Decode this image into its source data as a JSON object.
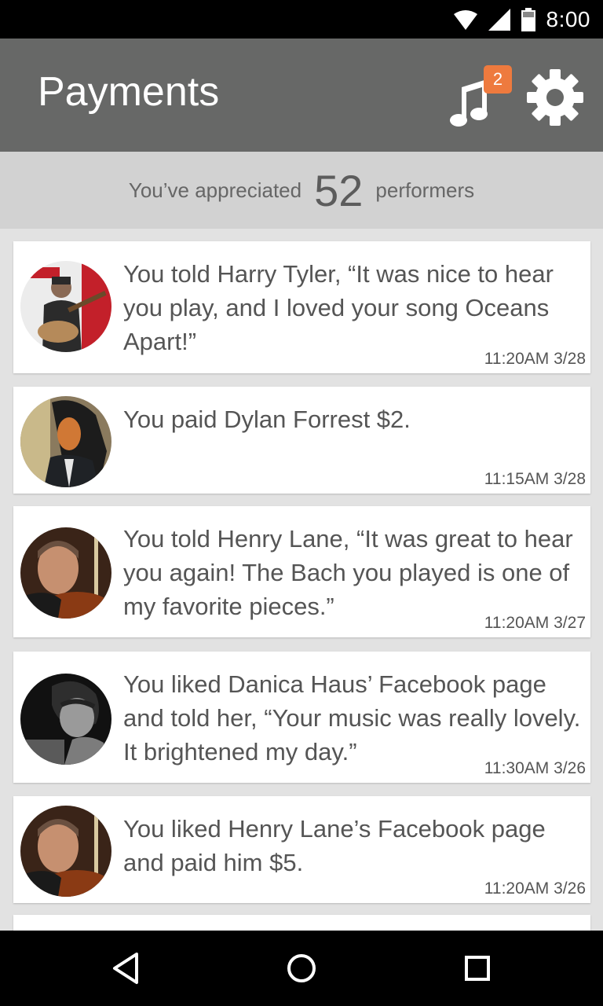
{
  "status_bar": {
    "time": "8:00",
    "icons": [
      "wifi-icon",
      "signal-icon",
      "battery-icon"
    ]
  },
  "header": {
    "title": "Payments",
    "notification_count": "2",
    "icons": [
      "music-note-icon",
      "gear-icon"
    ],
    "accent_color": "#ee7a3e",
    "bar_color": "#676867"
  },
  "summary": {
    "prefix": "You’ve appreciated",
    "count": "52",
    "suffix": "performers"
  },
  "feed": {
    "items": [
      {
        "text": "You told Harry Tyler, “It was nice to hear you play, and I loved your song Oceans Apart!”",
        "time": "11:20AM 3/28"
      },
      {
        "text": "You paid Dylan Forrest $2.",
        "time": "11:15AM 3/28"
      },
      {
        "text": "You told Henry Lane, “It was great to hear you again! The Bach you played is one of my favorite pieces.”",
        "time": "11:20AM 3/27"
      },
      {
        "text": "You liked Danica Haus’ Facebook page and told her, “Your music was really lovely. It brightened my day.”",
        "time": "11:30AM 3/26"
      },
      {
        "text": "You liked Henry Lane’s Facebook page and paid him $5.",
        "time": "11:20AM 3/26"
      }
    ]
  },
  "nav": {
    "icons": [
      "back-icon",
      "home-icon",
      "recents-icon"
    ]
  }
}
